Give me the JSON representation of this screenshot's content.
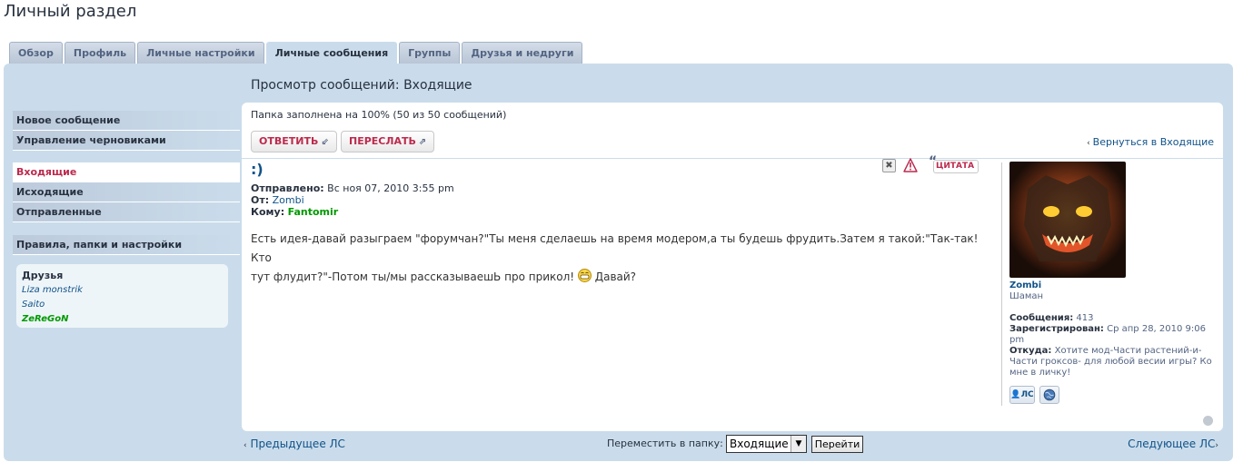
{
  "page": {
    "title": "Личный раздел"
  },
  "tabs": [
    {
      "label": "Обзор"
    },
    {
      "label": "Профиль"
    },
    {
      "label": "Личные настройки"
    },
    {
      "label": "Личные сообщения",
      "active": true
    },
    {
      "label": "Группы"
    },
    {
      "label": "Друзья и недруги"
    }
  ],
  "sidebar": {
    "group1": [
      "Новое сообщение",
      "Управление черновиками"
    ],
    "group2": [
      "Входящие",
      "Исходящие",
      "Отправленные"
    ],
    "group3": [
      "Правила, папки и настройки"
    ],
    "active": "Входящие",
    "friends": {
      "title": "Друзья",
      "list": [
        {
          "name": "Liza monstrik",
          "online": false
        },
        {
          "name": "Saito",
          "online": false
        },
        {
          "name": "ZeReGoN",
          "online": true
        }
      ]
    }
  },
  "main": {
    "title": "Просмотр сообщений: Входящие",
    "folder_status": "Папка заполнена на 100% (50 из 50 сообщений)",
    "reply_label": "ОТВЕТИТЬ",
    "forward_label": "ПЕРЕСЛАТЬ",
    "back_link": "Вернуться в Входящие"
  },
  "message": {
    "subject": ":)",
    "quote_label": "ЦИТАТА",
    "sent_label": "Отправлено:",
    "sent_value": "Вс ноя 07, 2010 3:55 pm",
    "from_label": "От:",
    "from_value": "Zombi",
    "to_label": "Кому:",
    "to_value": "Fantomir",
    "body_line1": "Есть идея-давай разыграем \"форумчан?\"Ты меня сделаешь на время модером,а ты будешь фрудить.Затем я такой:\"Так-так!Кто",
    "body_line2": "тут флудит?\"-Потом ты/мы рассказываешЬ про прикол!",
    "body_line2_end": "Давай?"
  },
  "profile": {
    "username": "Zombi",
    "rank": "Шаман",
    "posts_label": "Сообщения:",
    "posts_value": "413",
    "registered_label": "Зарегистрирован:",
    "registered_value": "Ср апр 28, 2010 9:06 pm",
    "from_label": "Откуда:",
    "from_value": "Хотите мод-Части растений-и-Части гроксов- для любой весии игры? Ко мне в личку!",
    "pm_label": "ЛС"
  },
  "footer": {
    "prev_label": "Предыдущее ЛС",
    "next_label": "Следующее ЛС",
    "move_label": "Переместить в папку:",
    "move_value": "Входящие",
    "go_label": "Перейти"
  },
  "colors": {
    "panel_bg": "#cadceb",
    "link": "#105289",
    "accent_red": "#bc2a4d",
    "online_green": "#009900"
  }
}
